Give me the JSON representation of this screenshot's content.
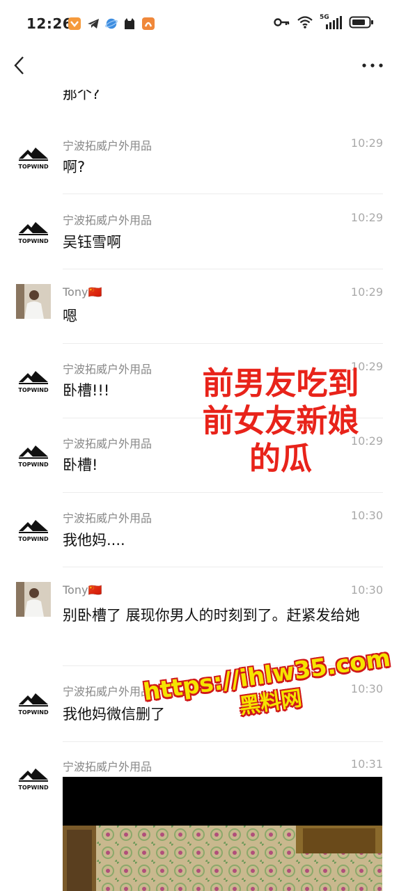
{
  "status": {
    "time": "12:26",
    "network": "5G"
  },
  "chat": {
    "partial_text": "那个?",
    "messages": [
      {
        "sender": "宁波拓威户外用品",
        "time": "10:29",
        "text": "啊?"
      },
      {
        "sender": "宁波拓威户外用品",
        "time": "10:29",
        "text": "吴钰雪啊"
      },
      {
        "sender": "Tony🇨🇳",
        "time": "10:29",
        "text": "嗯"
      },
      {
        "sender": "宁波拓威户外用品",
        "time": "10:29",
        "text": "卧槽!!!"
      },
      {
        "sender": "宁波拓威户外用品",
        "time": "10:29",
        "text": "卧槽!"
      },
      {
        "sender": "宁波拓威户外用品",
        "time": "10:30",
        "text": "我他妈...."
      },
      {
        "sender": "Tony🇨🇳",
        "time": "10:30",
        "text": "别卧槽了 展现你男人的时刻到了。赶紧发给她"
      },
      {
        "sender": "宁波拓威户外用品",
        "time": "10:30",
        "text": "我他妈微信删了"
      },
      {
        "sender": "宁波拓威户外用品",
        "time": "10:31",
        "text": ""
      }
    ],
    "logo_text": "TOPWIND"
  },
  "overlay": {
    "line1": "前男友吃到",
    "line2": "前女友新娘",
    "line3": "的瓜"
  },
  "watermark": {
    "url": "https://ihlw35.com",
    "name": "黑料网"
  }
}
